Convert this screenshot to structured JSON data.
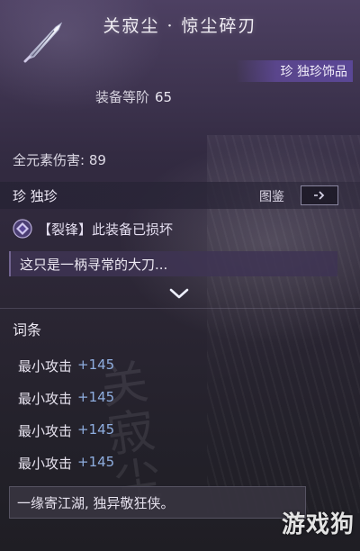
{
  "item": {
    "title": "关寂尘 · 惊尘碎刃",
    "icon": "blade-icon",
    "rarity_badge": "珍 独珍饰品",
    "level_label": "装备等阶",
    "level_value": "65",
    "stat_line": "全元素伤害: 89"
  },
  "rarity_row": {
    "label": "珍  独珍",
    "codex_label": "图鉴",
    "codex_icon": "chevron-right-icon"
  },
  "status": {
    "icon": "gem-icon",
    "text": "【裂锋】此装备已损坏"
  },
  "description": "这只是一柄寻常的大刀...",
  "affixes": {
    "title": "词条",
    "items": [
      {
        "name": "最小攻击",
        "value": "+145"
      },
      {
        "name": "最小攻击",
        "value": "+145"
      },
      {
        "name": "最小攻击",
        "value": "+145"
      },
      {
        "name": "最小攻击",
        "value": "+145"
      }
    ]
  },
  "motto": "一缘寄江湖, 独异敬狂侠。",
  "background_text": "关寂尘",
  "watermark": "游戏狗",
  "colors": {
    "rarity_purple": "#5a4796",
    "affix_value_blue": "#8faee0"
  }
}
